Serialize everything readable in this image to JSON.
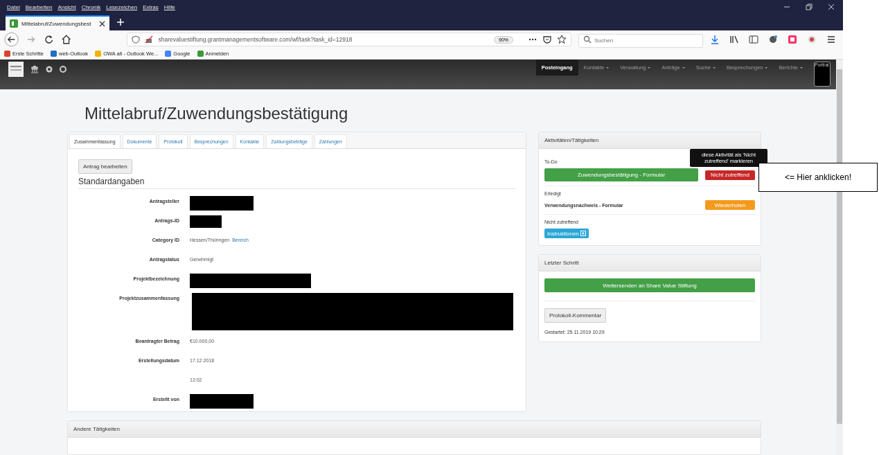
{
  "menu_bar": [
    "Datei",
    "Bearbeiten",
    "Ansicht",
    "Chronik",
    "Lesezeichen",
    "Extras",
    "Hilfe"
  ],
  "browser_tab": {
    "title": "Mittelabruf/Zuwendungsbest",
    "selected": true
  },
  "address_bar": {
    "url": "sharevaluestiftung.grantmanagementsoftware.com/wf/task?task_id=12918",
    "zoom": "90%"
  },
  "search": {
    "placeholder": "Suchen"
  },
  "bookmarks": [
    {
      "label": "Erste Schritte",
      "color": "#d9452b"
    },
    {
      "label": "web-Outlook",
      "color": "#1f6fc5"
    },
    {
      "label": "OWA alt - Outlook We...",
      "color": "#f0b400"
    },
    {
      "label": "Google",
      "color": "#4285f4"
    },
    {
      "label": "Anmelden",
      "color": "#3a9a3a"
    }
  ],
  "nav": [
    {
      "label": "Posteingang",
      "selected": true,
      "dropdown": false
    },
    {
      "label": "Kontakte",
      "selected": false,
      "dropdown": true
    },
    {
      "label": "Verwaltung",
      "selected": false,
      "dropdown": true
    },
    {
      "label": "Anträge",
      "selected": false,
      "dropdown": true
    },
    {
      "label": "Suche",
      "selected": false,
      "dropdown": true
    },
    {
      "label": "Besprechungen",
      "selected": false,
      "dropdown": true
    },
    {
      "label": "Berichte",
      "selected": false,
      "dropdown": true
    }
  ],
  "portrait_button": "Portrai",
  "page_title": "Mittelabruf/Zuwendungsbestätigung",
  "tabs": [
    {
      "label": "Zusammenfassung",
      "selected": true
    },
    {
      "label": "Dokumente",
      "selected": false
    },
    {
      "label": "Protokoll",
      "selected": false
    },
    {
      "label": "Besprechungen",
      "selected": false
    },
    {
      "label": "Kontakte",
      "selected": false
    },
    {
      "label": "Zahlungsbeträge",
      "selected": false
    },
    {
      "label": "Zahlungen",
      "selected": false
    }
  ],
  "edit_button": "Antrag bearbeiten",
  "section_title": "Standardangaben",
  "fields": [
    {
      "label": "Antragsteller",
      "kind": "redacted"
    },
    {
      "label": "Antrags-ID",
      "kind": "redacted"
    },
    {
      "label": "Category ID",
      "kind": "text",
      "value": "Hessen/Thüringen",
      "link": "Bereich"
    },
    {
      "label": "Antragstatus",
      "kind": "text",
      "value": "Genehmigt"
    },
    {
      "label": "Projektbezeichnung",
      "kind": "redacted"
    },
    {
      "label": "Projektzusammenfassung",
      "kind": "redacted"
    },
    {
      "label": "Beantragter Betrag",
      "kind": "text",
      "value": "€10.000,00"
    },
    {
      "label": "Erstellungsdatum",
      "kind": "text",
      "value": "17.12.2018"
    },
    {
      "kind": "text",
      "value": "12:02"
    },
    {
      "label": "Erstellt von",
      "kind": "redacted"
    }
  ],
  "activities": {
    "title": "Aktivitäten/Tätigkeiten",
    "todo_label": "To-Do",
    "todo_button": "Zuwendungsbestätigung - Formular",
    "not_applicable_button": "Nicht zutreffend",
    "tooltip": "diese Aktivität als 'Nicht zutreffend' markieren",
    "done_label": "Erledigt",
    "done_item": "Verwendungsnachweis - Formular",
    "repeat_button": "Wiederholen",
    "na_label": "Nicht zutreffend",
    "instructions_button": "Instruktionen"
  },
  "last_step": {
    "title": "Letzter Schritt",
    "forward_button": "Weitersenden an Share Value Stiftung",
    "comment_button": "Protokoll-Kommentar",
    "started": "Gestartet: 25.11.2019 10:29"
  },
  "other_activities": {
    "title": "Andere Tätigkeiten"
  },
  "callout": "<= Hier anklicken!"
}
